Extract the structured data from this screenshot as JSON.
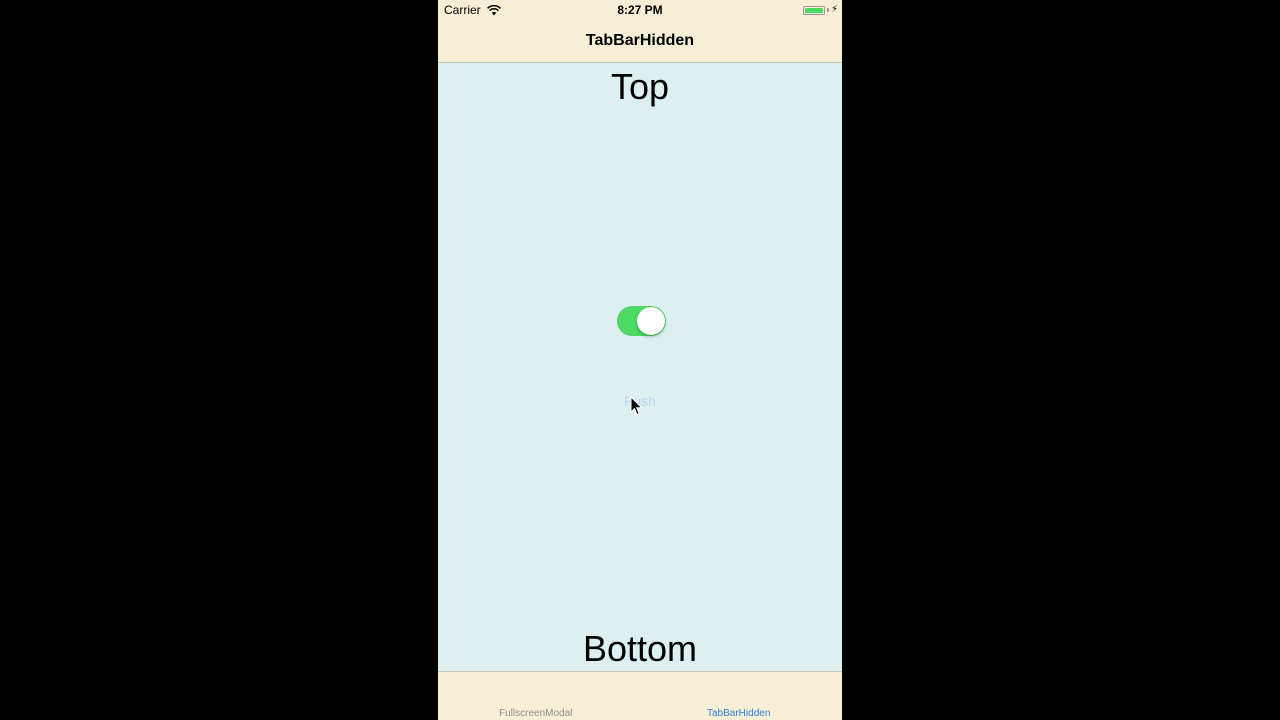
{
  "status_bar": {
    "carrier": "Carrier",
    "time": "8:27 PM",
    "wifi_icon": "wifi-icon",
    "battery_icon": "battery-icon",
    "charging_icon": "bolt-icon",
    "battery_color": "#4cd964"
  },
  "nav_bar": {
    "title": "TabBarHidden"
  },
  "content": {
    "top_label": "Top",
    "bottom_label": "Bottom",
    "toggle": {
      "on": true,
      "color": "#4cd964"
    },
    "push_label": "Push",
    "background": "#dcf0f2"
  },
  "tab_bar": {
    "tabs": [
      {
        "label": "FullscreenModal",
        "selected": false
      },
      {
        "label": "TabBarHidden",
        "selected": true
      }
    ],
    "selected_color": "#2f7fd6",
    "background": "#f6efd6"
  }
}
